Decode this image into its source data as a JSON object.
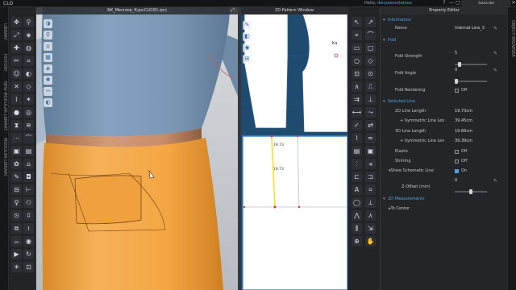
{
  "app": {
    "logo": "CLO",
    "user_prefix": "Hello,",
    "user_name": "denyaxovstatnos",
    "badge": "Subscribe",
    "controls": {
      "help": "?",
      "minimize": "—",
      "maximize": "▢",
      "close": "✕"
    }
  },
  "left_strip": {
    "tabs": [
      "LIBRARY",
      "HISTORY",
      "NEW MODULAR LIBRARY",
      "MODULAR LIBRARY"
    ]
  },
  "view3d": {
    "title": "БК_Мюллер_КурсCLO3D.zprj"
  },
  "view2d": {
    "title": "2D Pattern Window",
    "measure_top": "19.73",
    "measure_side": "19.73",
    "marker": "Ka"
  },
  "right_strip": {
    "label": "OBJECT BROWSER"
  },
  "property_editor": {
    "title": "Property Editor",
    "information": {
      "header": "Information",
      "name_label": "Name",
      "name_value": "Internal Line_3"
    },
    "fold": {
      "header": "Fold",
      "strength_label": "Fold Strength",
      "strength_value": "5",
      "angle_label": "Fold Angle",
      "angle_value": "0",
      "rendering_label": "Fold Rendering",
      "rendering_value": "Off",
      "strength_level": 0.1,
      "angle_level": 0.0
    },
    "selected_line": {
      "header": "Selected Line",
      "len2d_label": "2D Line Length",
      "len2d_value": "19.73cm",
      "sym2d_label": "+ Symmetric Line Len",
      "sym2d_value": "39.45cm",
      "len3d_label": "3D Line Length",
      "len3d_value": "19.66cm",
      "sym3d_label": "+ Symmetric Line Len",
      "sym3d_value": "39.39cm",
      "elastic_label": "Elastic",
      "elastic_value": "Off",
      "shirring_label": "Shirring",
      "shirring_value": "Off",
      "schematic_label": "Show Schematic Line",
      "schematic_value": "On",
      "zoffset_label": "Z-Offset (mm)",
      "zoffset_value": "0",
      "zoffset_level": 0.5
    },
    "measurements": {
      "header": "2D Measurements",
      "to_center_label": "To Center"
    }
  },
  "icons": {
    "caret_open": "▾",
    "caret_closed": "▸",
    "edit": "✎"
  },
  "colors": {
    "accent": "#4fa3e3",
    "shirt": "#7d9ab8",
    "skirt": "#f3a642",
    "pattern_bg": "#1f4b6e",
    "selected_line": "#f4e22f"
  }
}
